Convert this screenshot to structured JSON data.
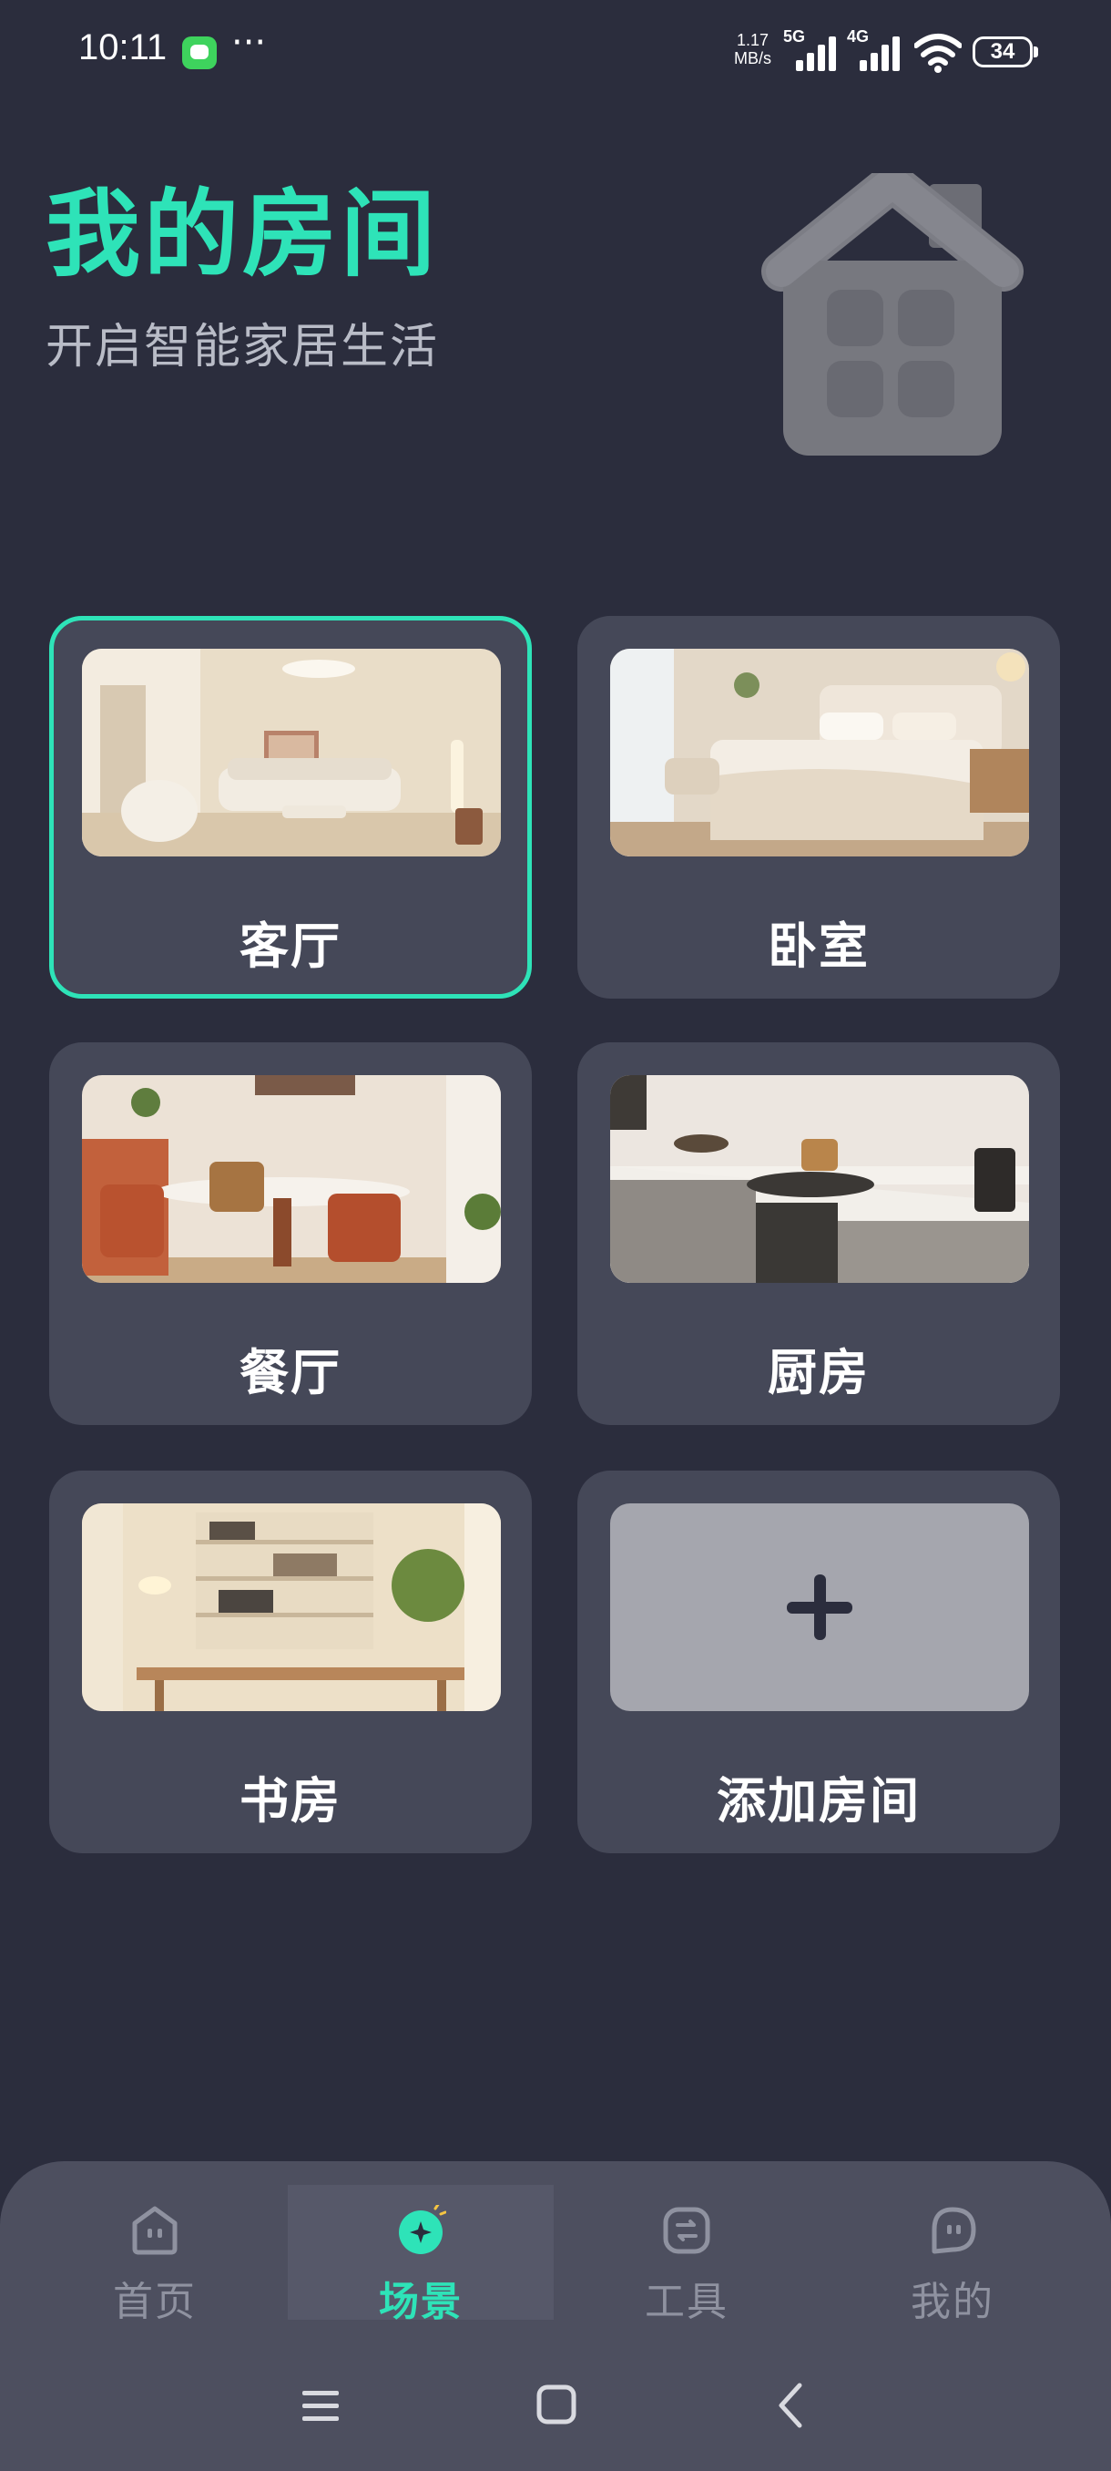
{
  "status_bar": {
    "time": "10:11",
    "more": "···",
    "speed_value": "1.17",
    "speed_unit": "MB/s",
    "net1": "5G",
    "net2": "4G",
    "battery": "34"
  },
  "header": {
    "title": "我的房间",
    "subtitle": "开启智能家居生活",
    "illustration": "house-icon"
  },
  "rooms": [
    {
      "label": "客厅",
      "image": "living-room-photo",
      "selected": true
    },
    {
      "label": "卧室",
      "image": "bedroom-photo",
      "selected": false
    },
    {
      "label": "餐厅",
      "image": "dining-room-photo",
      "selected": false
    },
    {
      "label": "厨房",
      "image": "kitchen-photo",
      "selected": false
    },
    {
      "label": "书房",
      "image": "study-photo",
      "selected": false
    },
    {
      "label": "添加房间",
      "image": "plus-icon",
      "selected": false
    }
  ],
  "nav": [
    {
      "label": "首页",
      "icon": "home-face-icon",
      "active": false
    },
    {
      "label": "场景",
      "icon": "scene-sparkle-icon",
      "active": true
    },
    {
      "label": "工具",
      "icon": "tools-icon",
      "active": false
    },
    {
      "label": "我的",
      "icon": "profile-chat-icon",
      "active": false
    }
  ],
  "colors": {
    "background": "#2b2d3d",
    "accent": "#2ee3b8",
    "card": "#454858",
    "nav_bar": "#4d4f5f",
    "inactive": "#8f92a0"
  }
}
